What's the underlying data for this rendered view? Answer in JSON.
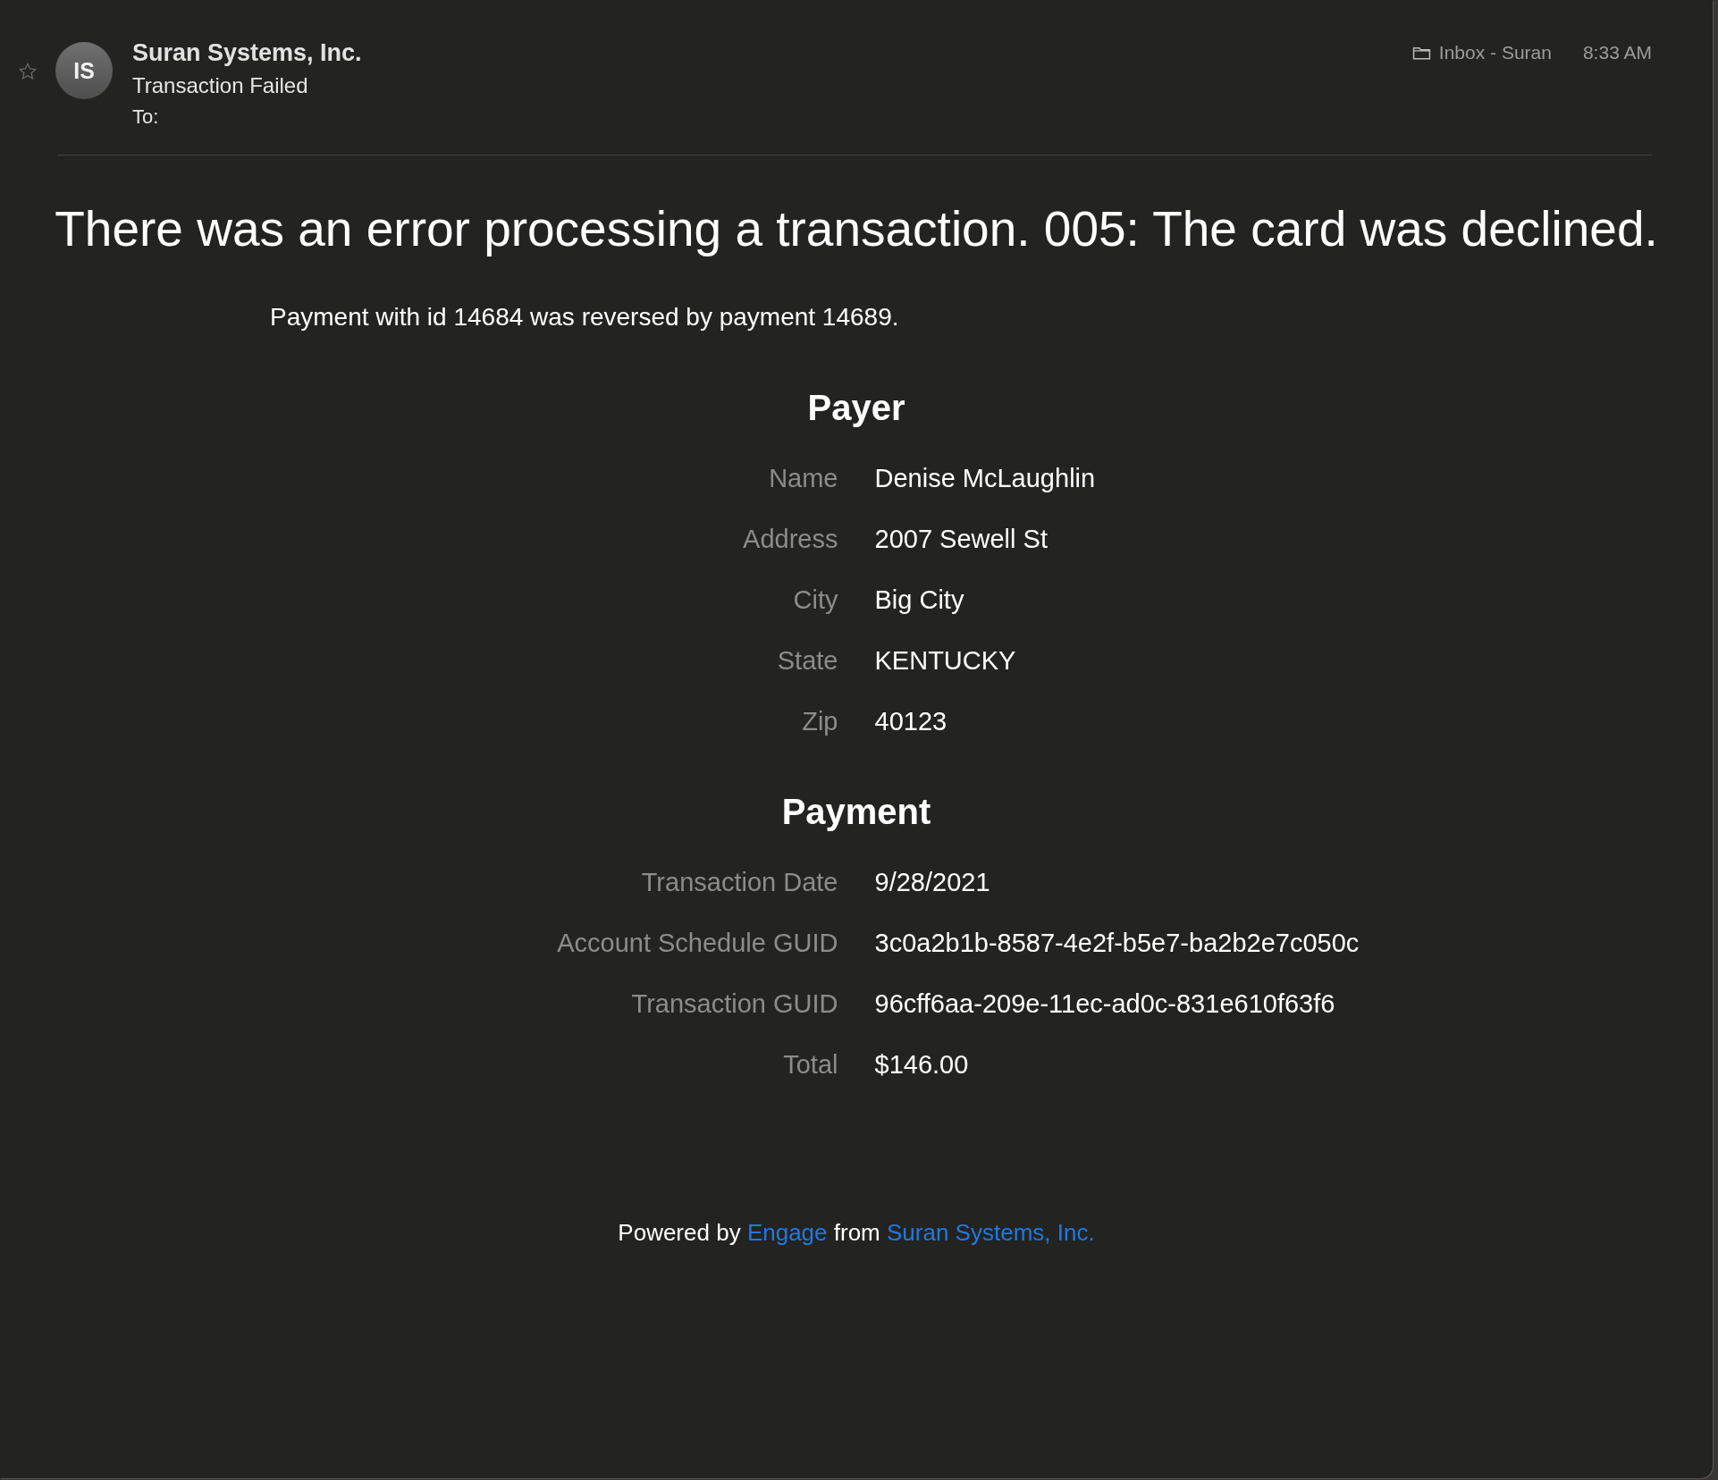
{
  "header": {
    "starred": false,
    "avatar_initials": "IS",
    "sender": "Suran Systems, Inc.",
    "subject": "Transaction Failed",
    "to_label": "To:",
    "mailbox": "Inbox - Suran",
    "time": "8:33 AM"
  },
  "headline": "There was an error processing a transaction. 005: The card was declined.",
  "note": "Payment with id 14684 was reversed by payment 14689.",
  "sections": [
    {
      "title": "Payer",
      "rows": [
        {
          "label": "Name",
          "value": "Denise McLaughlin"
        },
        {
          "label": "Address",
          "value": "2007 Sewell St"
        },
        {
          "label": "City",
          "value": "Big City"
        },
        {
          "label": "State",
          "value": "KENTUCKY"
        },
        {
          "label": "Zip",
          "value": "40123"
        }
      ]
    },
    {
      "title": "Payment",
      "rows": [
        {
          "label": "Transaction Date",
          "value": "9/28/2021"
        },
        {
          "label": "Account Schedule GUID",
          "value": "3c0a2b1b-8587-4e2f-b5e7-ba2b2e7c050c"
        },
        {
          "label": "Transaction GUID",
          "value": "96cff6aa-209e-11ec-ad0c-831e610f63f6"
        },
        {
          "label": "Total",
          "value": "$146.00"
        }
      ]
    }
  ],
  "footer": [
    {
      "kind": "text",
      "text": "Powered by"
    },
    {
      "kind": "link",
      "text": "Engage"
    },
    {
      "kind": "text",
      "text": "from"
    },
    {
      "kind": "link",
      "text": "Suran Systems, Inc."
    }
  ]
}
